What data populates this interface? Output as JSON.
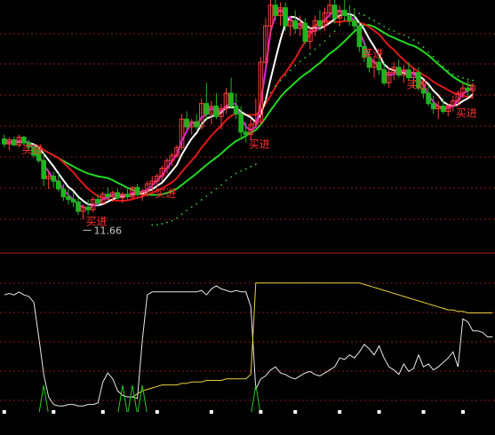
{
  "colors": {
    "background": "#000000",
    "grid": "#8a1a1a",
    "divider": "#b01818",
    "candle_up": "#00dcdc",
    "candle_down": "#1fb51f",
    "candle_doji": "#ffd000",
    "candle_wick": "#ff3c3c",
    "ma_white": "#ffffff",
    "ma_magenta": "#e020e0",
    "ma_red": "#e01818",
    "ma_green": "#22d822",
    "dots": "#30d030",
    "signal_text": "#ff3030",
    "low_label": "#c8c8c8",
    "osc_white": "#e8e8e8",
    "osc_yellow": "#e8d040",
    "osc_green": "#22c822",
    "osc_markers": "#ffffff"
  },
  "chart_data": [
    {
      "type": "candlestick",
      "title": "",
      "annotations": [
        {
          "text": "买进",
          "index": 3
        },
        {
          "text": "买进",
          "index": 16
        },
        {
          "text": "买进",
          "index": 30
        },
        {
          "text": "买进",
          "index": 49
        },
        {
          "text": "买进",
          "index": 72
        },
        {
          "text": "买进",
          "index": 81
        },
        {
          "text": "买进",
          "index": 91
        }
      ],
      "low_marker": {
        "text": "11.66",
        "index": 16,
        "value": 11.66
      },
      "ylim": [
        11.1,
        15.9
      ],
      "candles": [
        [
          13.22,
          13.3,
          13.05,
          13.12
        ],
        [
          13.12,
          13.25,
          13.0,
          13.2
        ],
        [
          13.2,
          13.26,
          13.08,
          13.1
        ],
        [
          13.1,
          13.3,
          13.05,
          13.25
        ],
        [
          13.25,
          13.28,
          13.1,
          13.14
        ],
        [
          13.14,
          13.2,
          13.0,
          13.06
        ],
        [
          13.06,
          13.12,
          12.85,
          12.9
        ],
        [
          13.0,
          13.08,
          12.75,
          12.8
        ],
        [
          12.8,
          12.95,
          12.3,
          12.45
        ],
        [
          12.45,
          12.6,
          12.25,
          12.5
        ],
        [
          12.5,
          12.58,
          12.28,
          12.4
        ],
        [
          12.4,
          12.55,
          12.2,
          12.25
        ],
        [
          12.25,
          12.35,
          12.02,
          12.1
        ],
        [
          12.1,
          12.25,
          11.95,
          12.05
        ],
        [
          12.05,
          12.2,
          11.9,
          12.0
        ],
        [
          12.0,
          12.08,
          11.75,
          11.82
        ],
        [
          11.82,
          11.95,
          11.66,
          11.9
        ],
        [
          11.9,
          12.05,
          11.75,
          11.85
        ],
        [
          11.85,
          12.1,
          11.8,
          12.05
        ],
        [
          12.05,
          12.15,
          11.92,
          11.98
        ],
        [
          11.98,
          12.2,
          11.95,
          12.15
        ],
        [
          12.15,
          12.28,
          12.05,
          12.1
        ],
        [
          12.1,
          12.22,
          12.0,
          12.18
        ],
        [
          12.18,
          12.26,
          12.05,
          12.08
        ],
        [
          12.08,
          12.2,
          11.98,
          12.15
        ],
        [
          12.15,
          12.25,
          12.05,
          12.1
        ],
        [
          12.1,
          12.3,
          12.06,
          12.28
        ],
        [
          12.28,
          12.35,
          12.1,
          12.14
        ],
        [
          12.14,
          12.25,
          12.02,
          12.2
        ],
        [
          12.2,
          12.4,
          12.1,
          12.35
        ],
        [
          12.35,
          12.5,
          12.2,
          12.4
        ],
        [
          12.4,
          12.55,
          12.3,
          12.5
        ],
        [
          12.5,
          12.7,
          12.4,
          12.65
        ],
        [
          12.65,
          12.85,
          12.55,
          12.8
        ],
        [
          12.8,
          12.95,
          12.7,
          12.9
        ],
        [
          12.9,
          13.1,
          12.85,
          13.05
        ],
        [
          13.05,
          13.7,
          13.0,
          13.6
        ],
        [
          13.6,
          13.75,
          13.4,
          13.45
        ],
        [
          13.45,
          13.6,
          13.3,
          13.55
        ],
        [
          13.55,
          13.7,
          13.4,
          13.45
        ],
        [
          13.45,
          14.0,
          13.4,
          13.9
        ],
        [
          13.9,
          14.3,
          13.6,
          13.7
        ],
        [
          13.7,
          13.95,
          13.5,
          13.85
        ],
        [
          13.85,
          14.1,
          13.6,
          13.65
        ],
        [
          13.65,
          13.9,
          13.4,
          13.8
        ],
        [
          13.8,
          14.2,
          13.7,
          14.1
        ],
        [
          14.1,
          14.4,
          13.8,
          13.85
        ],
        [
          13.85,
          14.1,
          13.6,
          13.7
        ],
        [
          13.7,
          13.85,
          13.25,
          13.35
        ],
        [
          13.35,
          13.55,
          13.15,
          13.3
        ],
        [
          13.3,
          13.6,
          13.2,
          13.5
        ],
        [
          13.5,
          14.0,
          13.45,
          13.55
        ],
        [
          13.55,
          14.8,
          13.5,
          14.7
        ],
        [
          14.7,
          15.55,
          14.6,
          15.4
        ],
        [
          15.4,
          15.9,
          15.2,
          15.8
        ],
        [
          15.8,
          15.9,
          15.5,
          15.6
        ],
        [
          15.6,
          15.85,
          15.4,
          15.75
        ],
        [
          15.75,
          15.85,
          15.3,
          15.4
        ],
        [
          15.4,
          15.6,
          15.2,
          15.5
        ],
        [
          15.5,
          15.7,
          15.25,
          15.35
        ],
        [
          15.35,
          15.6,
          15.2,
          15.45
        ],
        [
          15.45,
          15.55,
          15.05,
          15.1
        ],
        [
          15.1,
          15.4,
          14.95,
          15.3
        ],
        [
          15.3,
          15.6,
          15.2,
          15.5
        ],
        [
          15.5,
          15.7,
          15.3,
          15.4
        ],
        [
          15.4,
          15.75,
          15.3,
          15.65
        ],
        [
          15.65,
          15.9,
          15.55,
          15.8
        ],
        [
          15.8,
          15.9,
          15.45,
          15.55
        ],
        [
          15.55,
          15.8,
          15.4,
          15.7
        ],
        [
          15.7,
          15.9,
          15.5,
          15.6
        ],
        [
          15.6,
          15.8,
          15.4,
          15.5
        ],
        [
          15.5,
          15.7,
          15.3,
          15.4
        ],
        [
          15.4,
          15.5,
          14.9,
          15.0
        ],
        [
          15.0,
          15.1,
          14.7,
          14.8
        ],
        [
          14.8,
          14.95,
          14.5,
          14.6
        ],
        [
          14.6,
          14.8,
          14.4,
          14.7
        ],
        [
          14.7,
          14.85,
          14.45,
          14.55
        ],
        [
          14.55,
          14.7,
          14.25,
          14.3
        ],
        [
          14.3,
          14.6,
          14.2,
          14.5
        ],
        [
          14.5,
          14.7,
          14.35,
          14.6
        ],
        [
          14.6,
          14.75,
          14.4,
          14.45
        ],
        [
          14.45,
          14.65,
          14.3,
          14.55
        ],
        [
          14.55,
          14.7,
          14.35,
          14.4
        ],
        [
          14.4,
          14.6,
          14.2,
          14.5
        ],
        [
          14.5,
          14.6,
          14.15,
          14.2
        ],
        [
          14.2,
          14.35,
          14.0,
          14.1
        ],
        [
          14.1,
          14.25,
          13.85,
          13.9
        ],
        [
          13.9,
          14.05,
          13.7,
          13.8
        ],
        [
          13.8,
          13.95,
          13.6,
          13.85
        ],
        [
          13.85,
          14.0,
          13.7,
          13.75
        ],
        [
          13.75,
          13.9,
          13.65,
          13.85
        ],
        [
          13.85,
          14.05,
          13.75,
          13.95
        ],
        [
          13.95,
          14.15,
          13.85,
          14.1
        ],
        [
          14.1,
          14.3,
          14.0,
          14.2
        ],
        [
          14.2,
          14.35,
          14.05,
          14.15
        ],
        [
          14.15,
          14.3,
          14.0,
          14.25
        ]
      ]
    },
    {
      "type": "line",
      "series": [
        {
          "color_key": "osc_white",
          "values": [
            78,
            79,
            78,
            80,
            78,
            77,
            73,
            50,
            25,
            10,
            5,
            4,
            4,
            5,
            5,
            4,
            4,
            5,
            5,
            6,
            20,
            26,
            22,
            14,
            11,
            10,
            10,
            9,
            48,
            78,
            80,
            80,
            80,
            80,
            80,
            80,
            80,
            80,
            80,
            80,
            81,
            78,
            82,
            84,
            82,
            81,
            80,
            81,
            80,
            80,
            70,
            15,
            22,
            24,
            28,
            30,
            26,
            25,
            23,
            22,
            24,
            26,
            27,
            25,
            24,
            26,
            28,
            30,
            36,
            35,
            38,
            36,
            40,
            45,
            42,
            38,
            44,
            36,
            30,
            28,
            25,
            32,
            27,
            29,
            38,
            30,
            32,
            28,
            30,
            33,
            36,
            40,
            30,
            62,
            60,
            54,
            54,
            53,
            50,
            50
          ]
        },
        {
          "color_key": "osc_yellow",
          "values": [
            null,
            null,
            null,
            null,
            null,
            null,
            null,
            null,
            null,
            null,
            null,
            null,
            null,
            null,
            null,
            null,
            null,
            null,
            null,
            null,
            null,
            null,
            null,
            null,
            null,
            null,
            10,
            12,
            14,
            15,
            16,
            17,
            18,
            18,
            18,
            18,
            19,
            19,
            20,
            20,
            20,
            21,
            21,
            21,
            21,
            22,
            22,
            22,
            22,
            22,
            25,
            86,
            86,
            86,
            86,
            86,
            86,
            86,
            86,
            86,
            86,
            86,
            86,
            86,
            86,
            86,
            86,
            86,
            86,
            86,
            86,
            86,
            86,
            85,
            84,
            83,
            82,
            81,
            80,
            79,
            78,
            77,
            76,
            75,
            74,
            73,
            72,
            71,
            70,
            69,
            68,
            68,
            67,
            67,
            66,
            66,
            66,
            66,
            66,
            66
          ]
        }
      ],
      "spikes_green": [
        8,
        24,
        26,
        28,
        51
      ],
      "markers": [
        0,
        10,
        20,
        31,
        42,
        52,
        59,
        68,
        76,
        85,
        93
      ],
      "ylim": [
        0,
        100
      ]
    }
  ]
}
